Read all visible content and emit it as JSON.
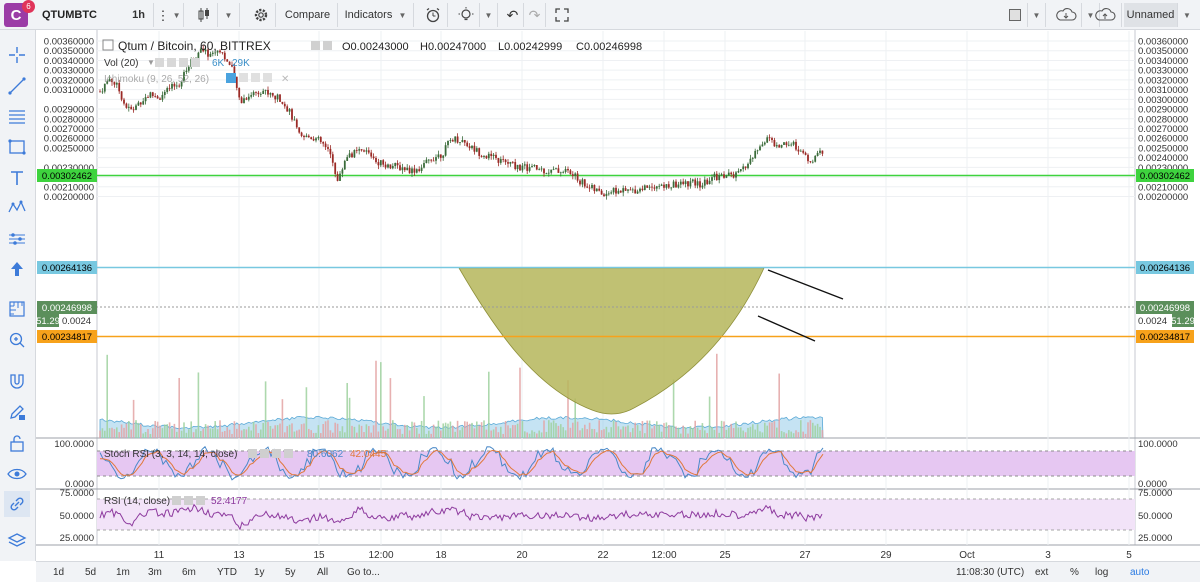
{
  "toolbar": {
    "badge": "6",
    "logo": "C",
    "symbol": "QTUMBTC",
    "interval": "1h",
    "compare": "Compare",
    "indicators": "Indicators",
    "layout_name": "Unnamed"
  },
  "legend": {
    "title": "Qtum / Bitcoin, 60, BITTREX",
    "open": "O0.00243000",
    "high": "H0.00247000",
    "low": "L0.00242999",
    "close": "C0.00246998",
    "vol_label": "Vol (20)",
    "vol_v1": "6K",
    "vol_v2": "29K",
    "ichimoku": "Ichimoku (9, 26, 52, 26)",
    "stoch_label": "Stoch RSI (3, 3, 14, 14, close)",
    "stoch_k": "80.6062",
    "stoch_d": "42.0445",
    "rsi_label": "RSI (14, close)",
    "rsi_value": "52.4177"
  },
  "price_axis": {
    "ticks": [
      "0.00360000",
      "0.00350000",
      "0.00340000",
      "0.00330000",
      "0.00320000",
      "0.00310000",
      "0.00300000",
      "0.00290000",
      "0.00280000",
      "0.00270000",
      "0.00260000",
      "0.00250000",
      "0.00240000",
      "0.00230000",
      "0.00220000",
      "0.00210000",
      "0.00200000"
    ],
    "left_ticks": [
      "0.00360000",
      "0.00350000",
      "0.00340000",
      "0.00330000",
      "0.00320000",
      "0.00310000",
      "0.00290000",
      "0.00280000",
      "0.00270000",
      "0.00260000",
      "0.00250000",
      "0.00230000",
      "0.00220000",
      "0.00210000",
      "0.00200000"
    ],
    "labels": {
      "green": "0.00302462",
      "blue": "0.00264136",
      "price": "0.00246998",
      "orange": "0.00234817",
      "rsi_small": "51.29",
      "partial": "0.0024"
    }
  },
  "stoch_axis": [
    "100.0000",
    "0.0000"
  ],
  "rsi_axis": [
    "75.0000",
    "50.0000",
    "25.0000"
  ],
  "time_axis": [
    "11",
    "13",
    "15",
    "12:00",
    "18",
    "20",
    "22",
    "12:00",
    "25",
    "27",
    "29",
    "Oct",
    "3",
    "5"
  ],
  "bottom": {
    "ranges": [
      "1d",
      "5d",
      "1m",
      "3m",
      "6m",
      "YTD",
      "1y",
      "5y",
      "All"
    ],
    "goto": "Go to...",
    "clock": "11:08:30 (UTC)",
    "ext": "ext",
    "percent": "%",
    "log": "log",
    "auto": "auto"
  },
  "colors": {
    "green_line": "#3ed33e",
    "blue_line": "#78c8e0",
    "orange_line": "#f7a21b",
    "price_label": "#5b8f5b",
    "candle_up": "#3a6b3a",
    "candle_down": "#9b2a26",
    "cup_fill": "#b5b65a",
    "volume": "#7fc0e4",
    "stoch_bg": "#e6c7f2",
    "rsi_bg": "#f2e3f8",
    "rsi_line": "#8d3a9e"
  }
}
